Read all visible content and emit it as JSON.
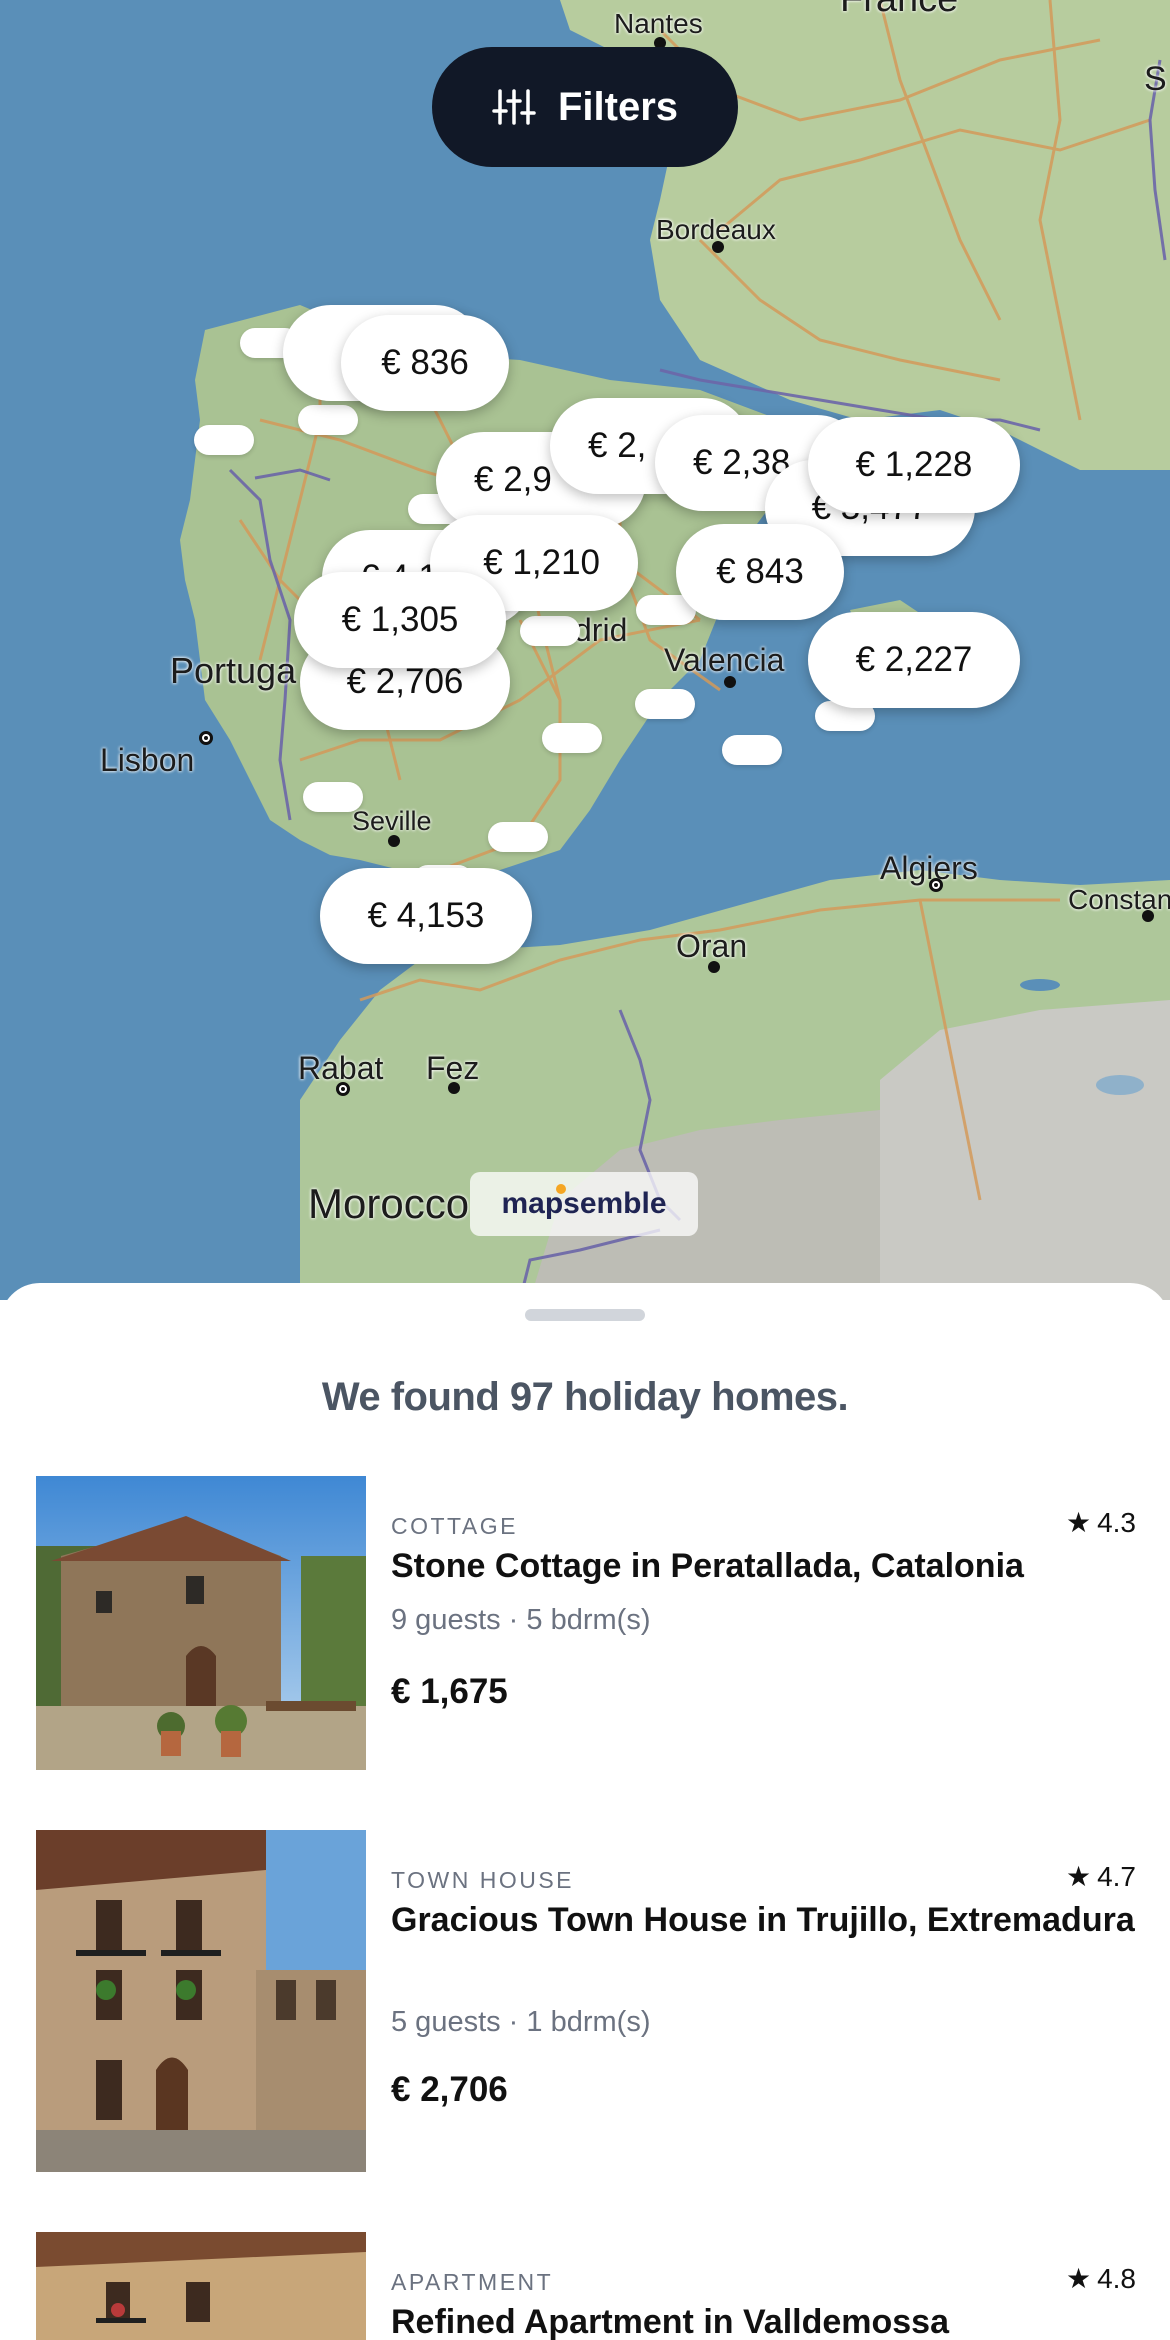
{
  "filters": {
    "label": "Filters"
  },
  "map": {
    "cities": {
      "nantes": "Nantes",
      "france": "France",
      "bordeaux": "Bordeaux",
      "portugal": "Portuga",
      "lisbon": "Lisbon",
      "madrid": "drid",
      "valencia": "Valencia",
      "seville": "Seville",
      "algiers": "Algiers",
      "constantine": "Constan",
      "oran": "Oran",
      "rabat": "Rabat",
      "fez": "Fez",
      "morocco": "Morocco"
    },
    "price_markers": [
      "€ 2",
      "€ 836",
      "€ 2,9",
      "€ 2,",
      "€ 2,38",
      "€ 3,477",
      "€ 1,228",
      "€ 4,181",
      "€ 1,210",
      "€ 843",
      "€ 1,305",
      "€ 2,706",
      "€ 2,227",
      "€ 4,153"
    ],
    "brand": "mapsemble"
  },
  "results": {
    "heading": "We found 97 holiday homes.",
    "listings": [
      {
        "type": "COTTAGE",
        "rating": "4.3",
        "title": "Stone Cottage in Peratallada, Catalonia",
        "meta": "9 guests · 5 bdrm(s)",
        "price": "€ 1,675"
      },
      {
        "type": "TOWN HOUSE",
        "rating": "4.7",
        "title": "Gracious Town House in Trujillo, Extremadura",
        "meta": "5 guests · 1 bdrm(s)",
        "price": "€ 2,706"
      },
      {
        "type": "APARTMENT",
        "rating": "4.8",
        "title": "Refined Apartment in Valldemossa",
        "meta": "",
        "price": ""
      }
    ]
  },
  "colors": {
    "sea": "#5a8fb8",
    "land": "#aec79a",
    "filters_bg": "#111827",
    "heading": "#4b5563",
    "muted": "#6b7280"
  },
  "icons": [
    "sliders-icon",
    "star-icon"
  ]
}
